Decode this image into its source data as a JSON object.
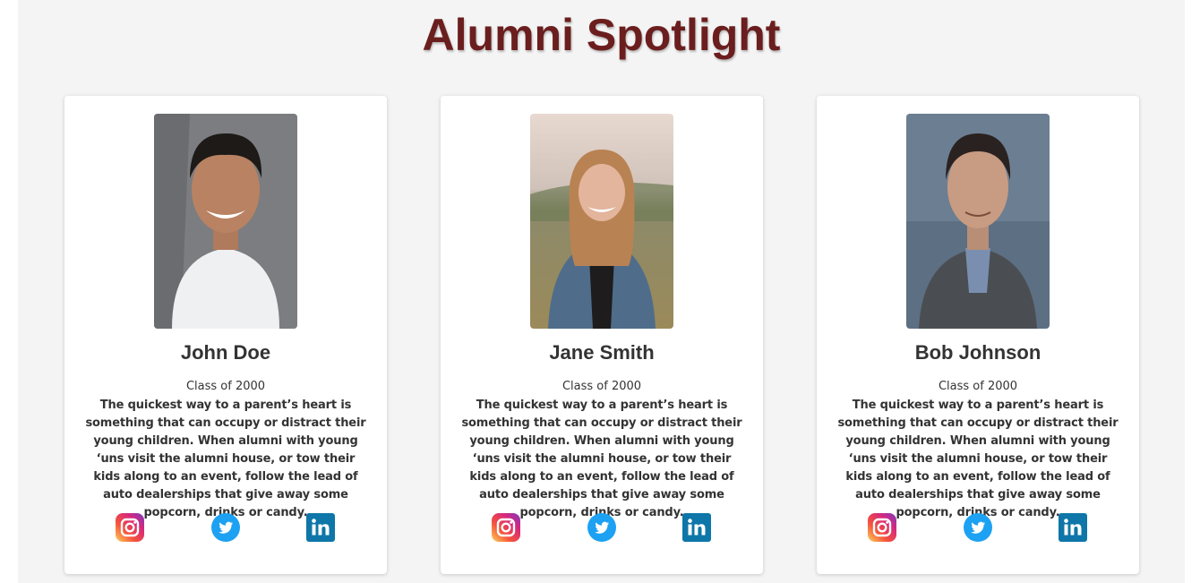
{
  "page": {
    "title": "Alumni Spotlight"
  },
  "alumni": [
    {
      "name": "John Doe",
      "class_year": "Class of 2000",
      "bio": "The quickest way to a parent’s heart is something that can occupy or distract their young children. When alumni with young ‘uns visit the alumni house, or tow their kids along to an event, follow the lead of auto dealerships that give away some popcorn, drinks or candy."
    },
    {
      "name": "Jane Smith",
      "class_year": "Class of 2000",
      "bio": "The quickest way to a parent’s heart is something that can occupy or distract their young children. When alumni with young ‘uns visit the alumni house, or tow their kids along to an event, follow the lead of auto dealerships that give away some popcorn, drinks or candy."
    },
    {
      "name": "Bob Johnson",
      "class_year": "Class of 2000",
      "bio": "The quickest way to a parent’s heart is something that can occupy or distract their young children. When alumni with young ‘uns visit the alumni house, or tow their kids along to an event, follow the lead of auto dealerships that give away some popcorn, drinks or candy."
    }
  ],
  "social_icons": [
    "instagram-icon",
    "twitter-icon",
    "linkedin-icon"
  ],
  "colors": {
    "title": "#6b1e1e",
    "background": "#f4f4f4",
    "card": "#ffffff",
    "twitter": "#1da1f2",
    "linkedin": "#0e76a8"
  }
}
